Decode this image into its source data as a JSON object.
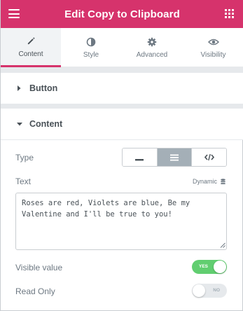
{
  "header": {
    "title": "Edit Copy to Clipboard",
    "menu_icon": "hamburger-menu-icon",
    "widgets_icon": "grid-icon",
    "background_color": "#d6336c"
  },
  "tabs": [
    {
      "label": "Content",
      "icon": "pencil-icon",
      "active": true
    },
    {
      "label": "Style",
      "icon": "half-circle-icon",
      "active": false
    },
    {
      "label": "Advanced",
      "icon": "gear-icon",
      "active": false
    },
    {
      "label": "Visibility",
      "icon": "eye-icon",
      "active": false
    }
  ],
  "sections": [
    {
      "label": "Button",
      "expanded": false
    },
    {
      "label": "Content",
      "expanded": true
    }
  ],
  "controls": {
    "type": {
      "label": "Type",
      "options": [
        "minus-icon",
        "menu-lines-icon",
        "code-icon"
      ],
      "selected": "menu-lines-icon"
    },
    "text": {
      "label": "Text",
      "dynamic_label": "Dynamic",
      "value": "Roses are red, Violets are blue, Be my Valentine and I'll be true to you!"
    },
    "visible_value": {
      "label": "Visible value",
      "state": "YES",
      "on": true
    },
    "read_only": {
      "label": "Read Only",
      "state": "NO",
      "on": false
    }
  },
  "colors": {
    "accent": "#d6336c",
    "switch_on": "#61ce70",
    "switch_off": "#e6e9ec",
    "selected_button": "#a4afb7"
  }
}
